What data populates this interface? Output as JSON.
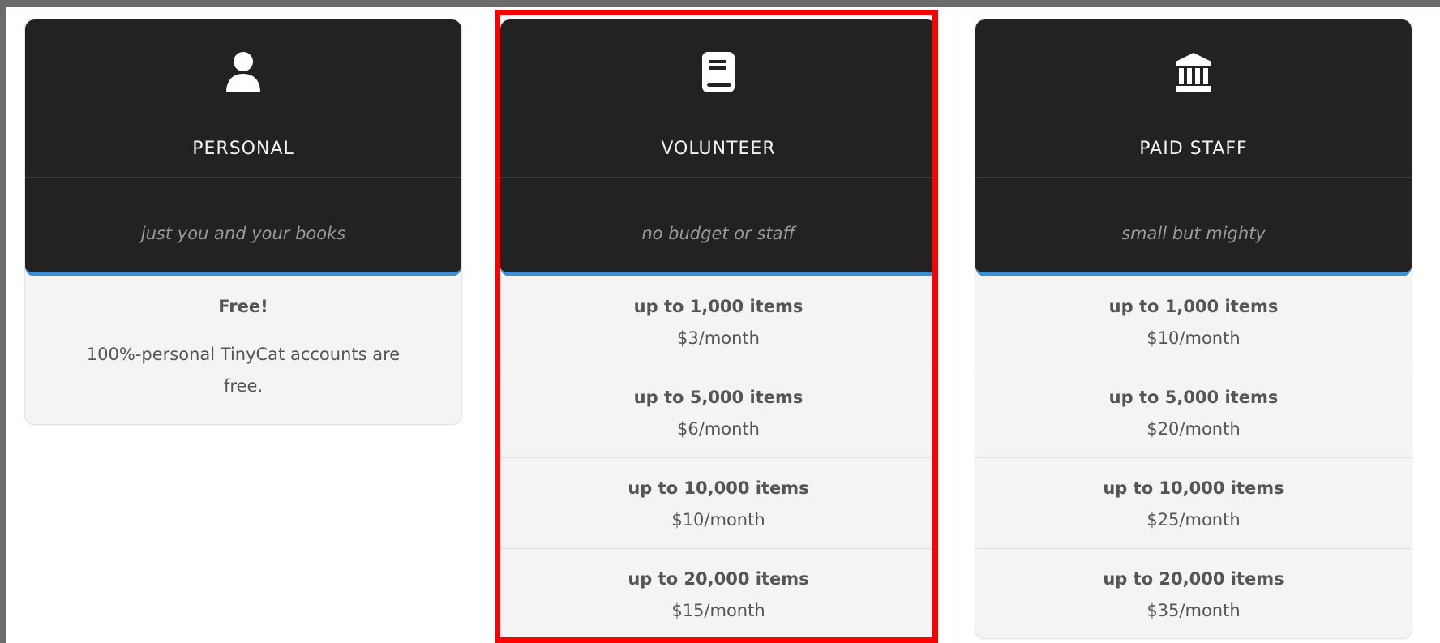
{
  "plans": {
    "personal": {
      "name": "PERSONAL",
      "icon": "user-icon",
      "tagline": "just you and your books",
      "price_title": "Free!",
      "description": "100%-personal TinyCat accounts are free."
    },
    "volunteer": {
      "name": "VOLUNTEER",
      "icon": "book-icon",
      "tagline": "no budget or staff",
      "tiers": [
        {
          "items": "up to 1,000 items",
          "price": "$3/month"
        },
        {
          "items": "up to 5,000 items",
          "price": "$6/month"
        },
        {
          "items": "up to 10,000 items",
          "price": "$10/month"
        },
        {
          "items": "up to 20,000 items",
          "price": "$15/month"
        }
      ]
    },
    "paid_staff": {
      "name": "PAID STAFF",
      "icon": "institution-icon",
      "tagline": "small but mighty",
      "tiers": [
        {
          "items": "up to 1,000 items",
          "price": "$10/month"
        },
        {
          "items": "up to 5,000 items",
          "price": "$20/month"
        },
        {
          "items": "up to 10,000 items",
          "price": "$25/month"
        },
        {
          "items": "up to 20,000 items",
          "price": "$35/month"
        }
      ]
    }
  },
  "colors": {
    "card_header": "#222222",
    "accent_bar": "#3d8fd6",
    "highlight_border": "#ff0000",
    "card_body": "#f4f4f4"
  }
}
